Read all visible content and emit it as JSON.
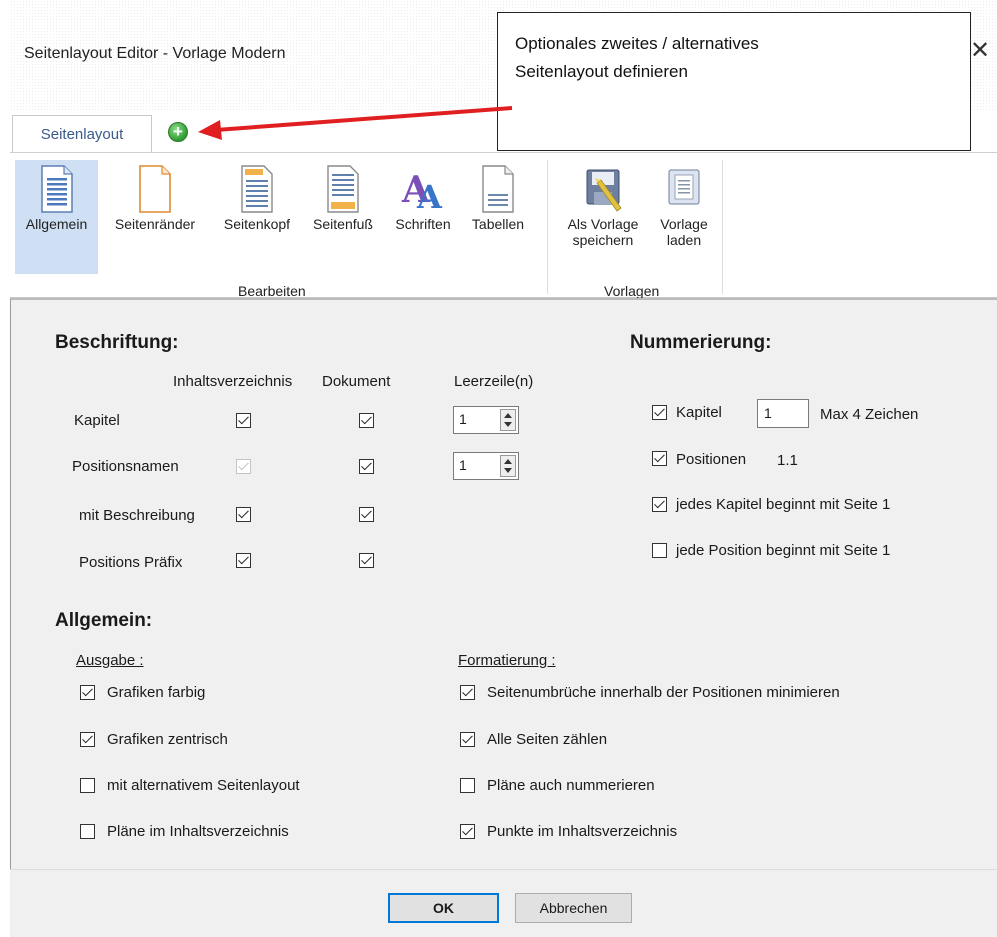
{
  "window": {
    "title": "Seitenlayout Editor - Vorlage Modern",
    "close_glyph": "✕"
  },
  "tabs": {
    "items": [
      {
        "label": "Seitenlayout"
      }
    ],
    "add_icon": "plus-circle-icon",
    "add_glyph": "+"
  },
  "callout": {
    "line1": "Optionales zweites / alternatives",
    "line2": "Seitenlayout definieren",
    "arrow_color": "#e02020"
  },
  "ribbon": {
    "bearbeiten": {
      "label": "Bearbeiten",
      "buttons": [
        {
          "label": "Allgemein",
          "icon": "general-page-icon",
          "selected": true
        },
        {
          "label": "Seitenränder",
          "icon": "margins-page-icon"
        },
        {
          "label": "Seitenkopf",
          "icon": "header-page-icon"
        },
        {
          "label": "Seitenfuß",
          "icon": "footer-page-icon"
        },
        {
          "label": "Schriften",
          "icon": "fonts-icon"
        },
        {
          "label": "Tabellen",
          "icon": "tables-page-icon"
        }
      ]
    },
    "vorlagen": {
      "label": "Vorlagen",
      "buttons": [
        {
          "label_line1": "Als Vorlage",
          "label_line2": "speichern",
          "icon": "save-template-icon"
        },
        {
          "label_line1": "Vorlage",
          "label_line2": "laden",
          "icon": "load-template-icon"
        }
      ]
    }
  },
  "beschriftung": {
    "heading": "Beschriftung:",
    "columns": {
      "toc": "Inhaltsverzeichnis",
      "document": "Dokument",
      "blank_lines": "Leerzeile(n)"
    },
    "rows": [
      {
        "label": "Kapitel",
        "toc": true,
        "toc_disabled": false,
        "document": true,
        "blank_lines": "1"
      },
      {
        "label": "Positionsnamen",
        "toc": true,
        "toc_disabled": true,
        "document": true,
        "blank_lines": "1"
      },
      {
        "label": "mit Beschreibung",
        "toc": true,
        "toc_disabled": false,
        "document": true
      },
      {
        "label": "Positions Präfix",
        "toc": true,
        "toc_disabled": false,
        "document": true
      }
    ]
  },
  "nummerierung": {
    "heading": "Nummerierung:",
    "kapitel": {
      "label": "Kapitel",
      "checked": true,
      "value": "1",
      "hint": "Max 4 Zeichen"
    },
    "positionen": {
      "label": "Positionen",
      "checked": true,
      "example": "1.1"
    },
    "kapitel_seite1": {
      "label": "jedes Kapitel beginnt mit Seite 1",
      "checked": true
    },
    "position_seite1": {
      "label": "jede Position beginnt mit Seite 1",
      "checked": false
    }
  },
  "allgemein": {
    "heading": "Allgemein:",
    "ausgabe": {
      "heading": "Ausgabe :",
      "options": [
        {
          "label": "Grafiken farbig",
          "checked": true
        },
        {
          "label": "Grafiken zentrisch",
          "checked": true
        },
        {
          "label": "mit alternativem Seitenlayout",
          "checked": false
        },
        {
          "label": "Pläne im Inhaltsverzeichnis",
          "checked": false
        }
      ]
    },
    "formatierung": {
      "heading": "Formatierung :",
      "options": [
        {
          "label": "Seitenumbrüche innerhalb der Positionen minimieren",
          "checked": true
        },
        {
          "label": "Alle Seiten zählen",
          "checked": true
        },
        {
          "label": "Pläne auch nummerieren",
          "checked": false
        },
        {
          "label": "Punkte im Inhaltsverzeichnis",
          "checked": true
        }
      ]
    }
  },
  "footer": {
    "ok": "OK",
    "cancel": "Abbrechen"
  }
}
